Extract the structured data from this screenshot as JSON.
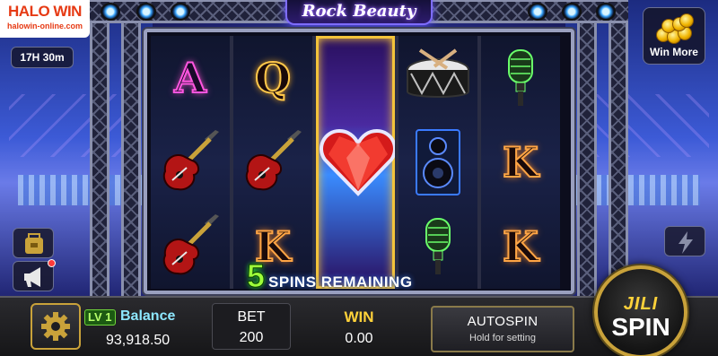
{
  "logo": {
    "brand": "HALO WIN",
    "site": "halowin-online.com"
  },
  "game_title": "Rock Beauty",
  "timer": "17H 30m",
  "win_more": {
    "label": "Win More",
    "icon": "gold-coins-icon"
  },
  "reels": [
    [
      "A",
      "electric-guitar",
      "electric-guitar"
    ],
    [
      "Q",
      "electric-guitar",
      "K"
    ],
    [
      "heart-gem",
      "heart-gem",
      "heart-gem"
    ],
    [
      "drum",
      "speaker",
      "microphone"
    ],
    [
      "microphone",
      "K",
      "K"
    ]
  ],
  "free_spins": {
    "count": "5",
    "label": "SPINS REMAINING"
  },
  "bottom": {
    "level": "LV 1",
    "balance_label": "Balance",
    "balance_value": "93,918.50",
    "bet_label": "BET",
    "bet_value": "200",
    "win_label": "WIN",
    "win_value": "0.00",
    "autospin_label": "AUTOSPIN",
    "autospin_hint": "Hold for setting",
    "spin_brand": "JILI",
    "spin_label": "SPIN"
  },
  "colors": {
    "accent_gold": "#f3c33b",
    "free_spin_green": "#9dff3a",
    "balance_cyan": "#8de7ff"
  }
}
